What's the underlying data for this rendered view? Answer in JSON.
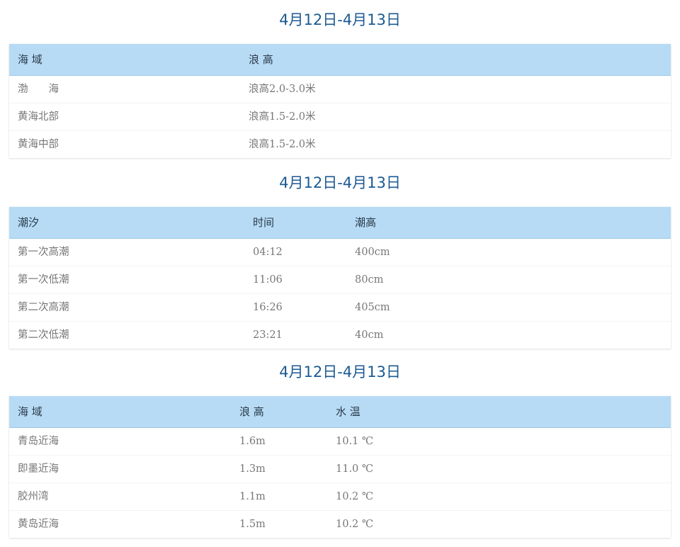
{
  "wave_forecast": {
    "title": "4月12日-4月13日",
    "headers": [
      "海 域",
      "浪 高"
    ],
    "rows": [
      [
        "渤　　海",
        "浪高2.0-3.0米"
      ],
      [
        "黄海北部",
        "浪高1.5-2.0米"
      ],
      [
        "黄海中部",
        "浪高1.5-2.0米"
      ]
    ]
  },
  "tide_forecast": {
    "title": "4月12日-4月13日",
    "headers": [
      "潮汐",
      "时间",
      "潮高"
    ],
    "rows": [
      [
        "第一次高潮",
        "04:12",
        "400cm"
      ],
      [
        "第一次低潮",
        "11:06",
        "80cm"
      ],
      [
        "第二次高潮",
        "16:26",
        "405cm"
      ],
      [
        "第二次低潮",
        "23:21",
        "40cm"
      ]
    ]
  },
  "coastal_forecast": {
    "title": "4月12日-4月13日",
    "headers": [
      "海 域",
      "浪 高",
      "水 温"
    ],
    "rows": [
      [
        "青岛近海",
        "1.6m",
        "10.1 ℃"
      ],
      [
        "即墨近海",
        "1.3m",
        "11.0 ℃"
      ],
      [
        "胶州湾",
        "1.1m",
        "10.2 ℃"
      ],
      [
        "黄岛近海",
        "1.5m",
        "10.2 ℃"
      ]
    ]
  }
}
